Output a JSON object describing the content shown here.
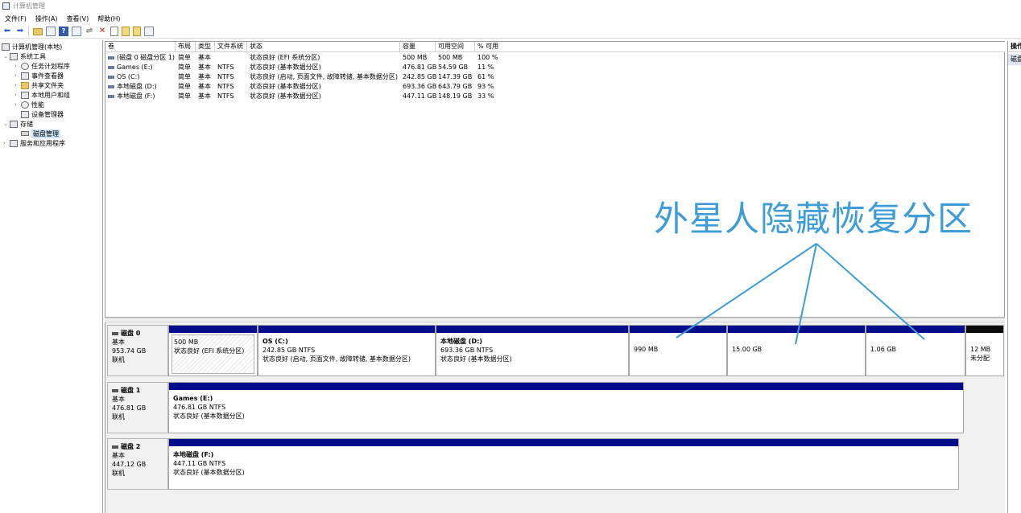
{
  "window": {
    "title": "计算机管理"
  },
  "menu": [
    "文件(F)",
    "操作(A)",
    "查看(V)",
    "帮助(H)"
  ],
  "tree": [
    {
      "label": "计算机管理(本地)",
      "expander": "",
      "selected": false
    },
    {
      "label": "系统工具",
      "expander": "⌄",
      "selected": false
    },
    {
      "label": "任务计划程序",
      "expander": "›",
      "selected": false
    },
    {
      "label": "事件查看器",
      "expander": "›",
      "selected": false
    },
    {
      "label": "共享文件夹",
      "expander": "›",
      "selected": false
    },
    {
      "label": "本地用户和组",
      "expander": "›",
      "selected": false
    },
    {
      "label": "性能",
      "expander": "›",
      "selected": false
    },
    {
      "label": "设备管理器",
      "expander": "",
      "selected": false
    },
    {
      "label": "存储",
      "expander": "⌄",
      "selected": false
    },
    {
      "label": "磁盘管理",
      "expander": "",
      "selected": true
    },
    {
      "label": "服务和应用程序",
      "expander": "›",
      "selected": false
    }
  ],
  "volumes": {
    "columns": [
      "卷",
      "布局",
      "类型",
      "文件系统",
      "状态",
      "容量",
      "可用空间",
      "% 可用"
    ],
    "rows": [
      [
        "(磁盘 0 磁盘分区 1)",
        "简单",
        "基本",
        "",
        "状态良好 (EFI 系统分区)",
        "500 MB",
        "500 MB",
        "100 %"
      ],
      [
        "Games (E:)",
        "简单",
        "基本",
        "NTFS",
        "状态良好 (基本数据分区)",
        "476.81 GB",
        "54.59 GB",
        "11 %"
      ],
      [
        "OS (C:)",
        "简单",
        "基本",
        "NTFS",
        "状态良好 (启动, 页面文件, 故障转储, 基本数据分区)",
        "242.85 GB",
        "147.39 GB",
        "61 %"
      ],
      [
        "本地磁盘 (D:)",
        "简单",
        "基本",
        "NTFS",
        "状态良好 (基本数据分区)",
        "693.36 GB",
        "643.79 GB",
        "93 %"
      ],
      [
        "本地磁盘 (F:)",
        "简单",
        "基本",
        "NTFS",
        "状态良好 (基本数据分区)",
        "447.11 GB",
        "148.19 GB",
        "33 %"
      ]
    ]
  },
  "disks": [
    {
      "name": "磁盘 0",
      "type": "基本",
      "size": "953.74 GB",
      "state": "联机",
      "partitions": [
        {
          "title": "",
          "line1": "500 MB",
          "line2": "状态良好 (EFI 系统分区)",
          "hatched": true,
          "unallocated": false
        },
        {
          "title": "OS  (C:)",
          "line1": "242.85 GB NTFS",
          "line2": "状态良好 (启动, 页面文件, 故障转储, 基本数据分区)",
          "hatched": false,
          "unallocated": false
        },
        {
          "title": "本地磁盘  (D:)",
          "line1": "693.36 GB NTFS",
          "line2": "状态良好 (基本数据分区)",
          "hatched": false,
          "unallocated": false
        },
        {
          "title": "",
          "line1": "990 MB",
          "line2": "",
          "hatched": false,
          "unallocated": false
        },
        {
          "title": "",
          "line1": "15.00 GB",
          "line2": "",
          "hatched": false,
          "unallocated": false
        },
        {
          "title": "",
          "line1": "1.06 GB",
          "line2": "",
          "hatched": false,
          "unallocated": false
        },
        {
          "title": "",
          "line1": "12 MB",
          "line2": "未分配",
          "hatched": false,
          "unallocated": true
        }
      ]
    },
    {
      "name": "磁盘 1",
      "type": "基本",
      "size": "476.81 GB",
      "state": "联机",
      "partitions": [
        {
          "title": "Games  (E:)",
          "line1": "476.81 GB NTFS",
          "line2": "状态良好 (基本数据分区)",
          "hatched": false,
          "unallocated": false
        }
      ]
    },
    {
      "name": "磁盘 2",
      "type": "基本",
      "size": "447.12 GB",
      "state": "联机",
      "partitions": [
        {
          "title": "本地磁盘  (F:)",
          "line1": "447.11 GB NTFS",
          "line2": "状态良好 (基本数据分区)",
          "hatched": false,
          "unallocated": false
        }
      ]
    }
  ],
  "actions": {
    "header": "操作",
    "item": "磁盘管理"
  },
  "annotation": {
    "text": "外星人隐藏恢复分区",
    "color": "#3e9cd6"
  }
}
